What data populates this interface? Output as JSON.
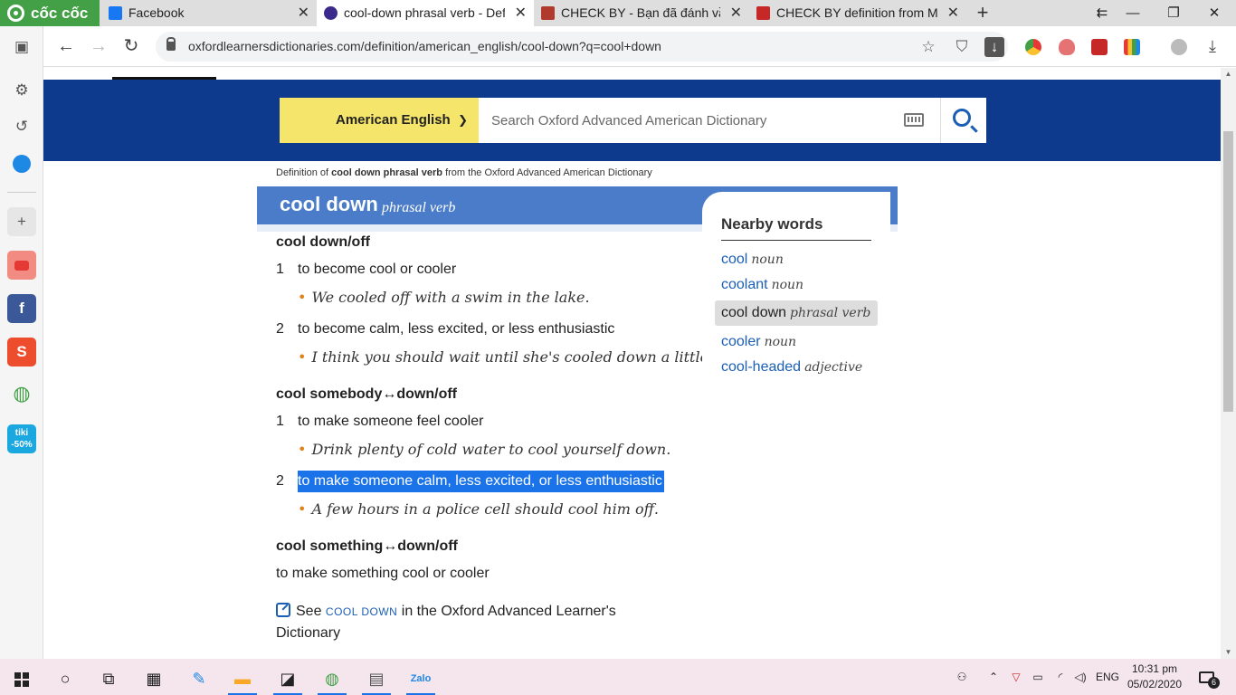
{
  "browser": {
    "brand": "cốc cốc",
    "tabs": [
      {
        "title": "Facebook",
        "color": "#1877f2"
      },
      {
        "title": "cool-down phrasal verb - Def",
        "color": "#3b2a8c"
      },
      {
        "title": "CHECK BY - Bạn đã đánh vần",
        "color": "#b03a2e"
      },
      {
        "title": "CHECK BY definition from Ma",
        "color": "#c62828"
      }
    ],
    "url": "oxfordlearnersdictionaries.com/definition/american_english/cool-down?q=cool+down"
  },
  "site": {
    "language": "American English",
    "search_placeholder": "Search Oxford Advanced American Dictionary"
  },
  "entry": {
    "breadcrumb_prefix": "Definition of",
    "breadcrumb_term": "cool down phrasal verb",
    "breadcrumb_suffix": "from the Oxford Advanced American Dictionary",
    "headword": "cool down",
    "pos": "phrasal verb",
    "groups": [
      {
        "phrase": "cool down/off",
        "senses": [
          {
            "num": "1",
            "def": "to become cool or cooler",
            "example": "We cooled off with a swim in the lake."
          },
          {
            "num": "2",
            "def": "to become calm, less excited, or less enthusiastic",
            "example": "I think you should wait until she's cooled down a little."
          }
        ]
      },
      {
        "phrase": "cool somebody↔down/off",
        "senses": [
          {
            "num": "1",
            "def": "to make someone feel cooler",
            "example": "Drink plenty of cold water to cool yourself down."
          },
          {
            "num": "2",
            "def": "to make someone calm, less excited, or less enthusiastic",
            "example": "A few hours in a police cell should cool him off."
          }
        ]
      },
      {
        "phrase": "cool something↔down/off",
        "def": "to make something cool or cooler"
      }
    ],
    "see_prefix": "See",
    "see_link": "cool down",
    "see_suffix": "in the Oxford Advanced Learner's Dictionary"
  },
  "nearby": {
    "title": "Nearby words",
    "items": [
      {
        "word": "cool",
        "pos": "noun"
      },
      {
        "word": "coolant",
        "pos": "noun"
      },
      {
        "word": "cool down",
        "pos": "phrasal verb",
        "current": true
      },
      {
        "word": "cooler",
        "pos": "noun"
      },
      {
        "word": "cool-headed",
        "pos": "adjective"
      }
    ]
  },
  "taskbar": {
    "language": "ENG",
    "time": "10:31 pm",
    "date": "05/02/2020",
    "notifications": "6"
  },
  "colors": {
    "hero": "#0d3a8c",
    "headword_bar": "#4a7cc9",
    "language_select": "#f5e66b",
    "link": "#1a5fb4",
    "highlight": "#1a73e8"
  }
}
